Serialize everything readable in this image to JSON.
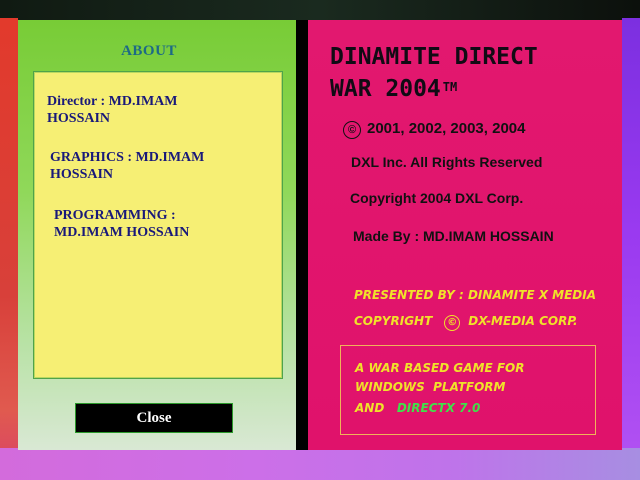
{
  "about": {
    "title": "ABOUT",
    "credits": [
      {
        "line1": "Director : MD.IMAM",
        "line2": "HOSSAIN"
      },
      {
        "line1": "GRAPHICS : MD.IMAM",
        "line2": "HOSSAIN"
      },
      {
        "line1": "PROGRAMMING :",
        "line2": "MD.IMAM HOSSAIN"
      }
    ],
    "close_label": "Close"
  },
  "info": {
    "title_line1": "DINAMITE DIRECT",
    "title_line2": "WAR 2004",
    "trademark": "TM",
    "copyright_symbol": "©",
    "years": "2001, 2002, 2003, 2004",
    "rights": "DXL Inc. All Rights Reserved",
    "copyright_line": "Copyright 2004 DXL Corp.",
    "made_by": "Made By : MD.IMAM HOSSAIN",
    "presented_by": "PRESENTED BY : DINAMITE X MEDIA",
    "copyright_label": "COPYRIGHT",
    "copyright_owner": "DX-MEDIA CORP.",
    "description": {
      "line1": "A WAR BASED GAME FOR",
      "line2": "WINDOWS  PLATFORM",
      "line3_prefix": "AND",
      "line3_highlight": "DIRECTX 7.0"
    }
  },
  "colors": {
    "left_panel": "#8fd655",
    "credits_box": "#f6ef74",
    "right_panel": "#e2186f",
    "yellow_text": "#f0e22a",
    "green_text": "#41e04a"
  }
}
